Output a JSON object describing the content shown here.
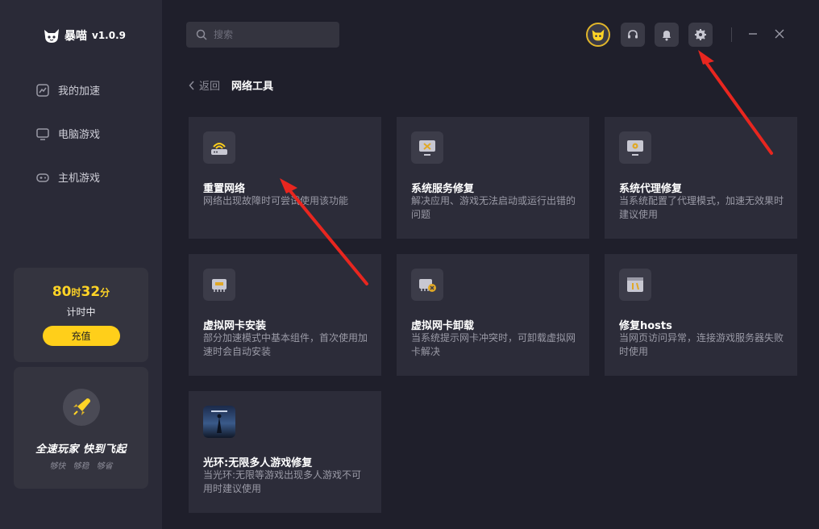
{
  "app": {
    "name": "暴喵",
    "version": "v1.0.9"
  },
  "sidebar": {
    "items": [
      {
        "label": "我的加速",
        "icon": "speed-chart-icon"
      },
      {
        "label": "电脑游戏",
        "icon": "monitor-icon"
      },
      {
        "label": "主机游戏",
        "icon": "gamepad-icon"
      }
    ],
    "timer": {
      "hours": "80",
      "hours_unit": "时",
      "minutes": "32",
      "minutes_unit": "分",
      "status": "计时中",
      "recharge_label": "充值"
    },
    "promo": {
      "title": "全速玩家  快到飞起",
      "subtitle": "够快 够稳 够省"
    }
  },
  "search": {
    "placeholder": "搜索"
  },
  "header": {
    "back_label": "返回",
    "page_title": "网络工具"
  },
  "tools": [
    {
      "title": "重置网络",
      "desc": "网络出现故障时可尝试使用该功能",
      "icon": "router-icon"
    },
    {
      "title": "系统服务修复",
      "desc": "解决应用、游戏无法启动或运行出错的问题",
      "icon": "repair-monitor-icon"
    },
    {
      "title": "系统代理修复",
      "desc": "当系统配置了代理模式，加速无效果时建议使用",
      "icon": "proxy-gear-icon"
    },
    {
      "title": "虚拟网卡安装",
      "desc": "部分加速模式中基本组件，首次使用加速时会自动安装",
      "icon": "network-card-icon"
    },
    {
      "title": "虚拟网卡卸载",
      "desc": "当系统提示网卡冲突时，可卸载虚拟网卡解决",
      "icon": "network-card-remove-icon"
    },
    {
      "title": "修复hosts",
      "desc": "当网页访问异常，连接游戏服务器失败时使用",
      "icon": "hosts-tools-icon"
    },
    {
      "title": "光环:无限多人游戏修复",
      "desc": "当光环:无限等游戏出现多人游戏不可用时建议使用",
      "icon": "halo-game-thumbnail"
    }
  ],
  "colors": {
    "accent": "#ffcf1a",
    "sidebar_bg": "#2a2a37",
    "main_bg": "#1f1f2b",
    "card_bg": "#2c2c39",
    "arrow": "#e8261f"
  }
}
